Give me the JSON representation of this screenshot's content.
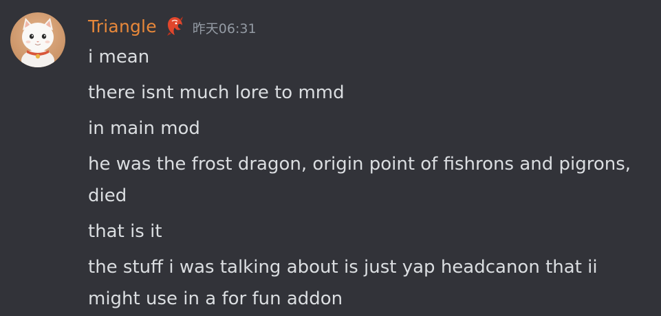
{
  "message": {
    "username": "Triangle",
    "timestamp": "昨天06:31",
    "role_icon": "dragon-icon",
    "avatar": "cat-avatar",
    "username_color": "#e8883a",
    "lines": [
      "i mean",
      "there isnt much lore to mmd",
      "in main mod",
      "he was the frost dragon, origin point of fishrons and pigrons, died",
      "that is it",
      "the stuff i was talking about is just yap headcanon that ii might use in a for fun addon"
    ]
  }
}
